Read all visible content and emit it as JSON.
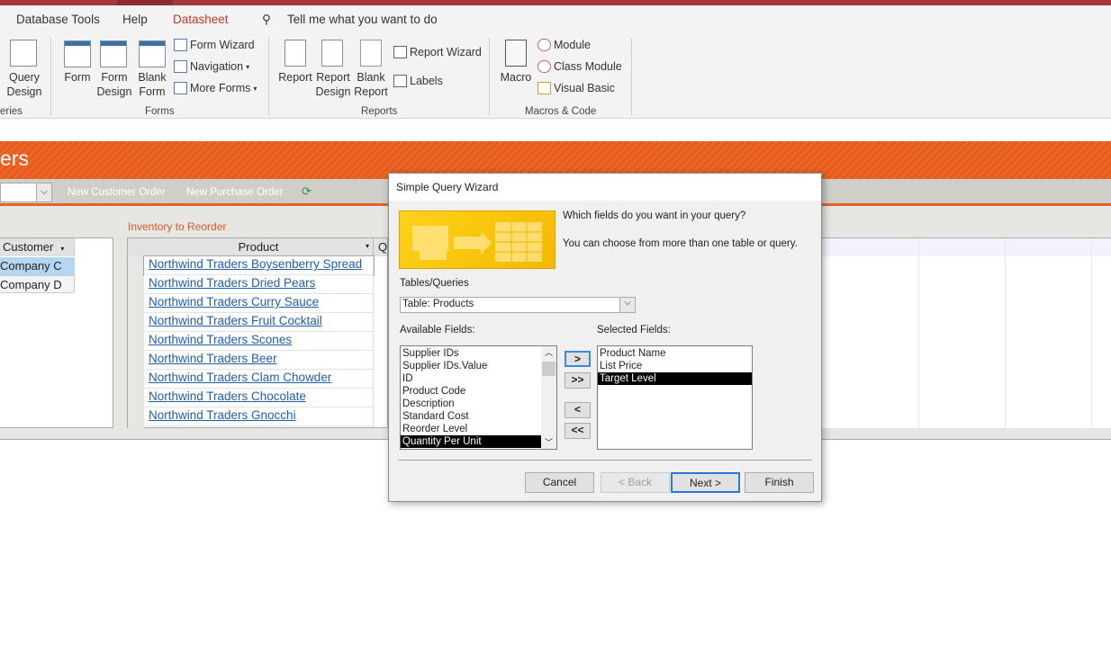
{
  "menu": {
    "items": [
      "Database Tools",
      "Help",
      "Datasheet"
    ],
    "tell_me": "Tell me what you want to do",
    "active_color": "#c0392b"
  },
  "ribbon": {
    "queries": {
      "query_design": [
        "Query",
        "Design"
      ],
      "group": "eries"
    },
    "forms": {
      "form": "Form",
      "form_design": [
        "Form",
        "Design"
      ],
      "blank_form": [
        "Blank",
        "Form"
      ],
      "form_wizard": "Form Wizard",
      "navigation": "Navigation",
      "more_forms": "More Forms",
      "group": "Forms"
    },
    "reports": {
      "report": "Report",
      "report_design": [
        "Report",
        "Design"
      ],
      "blank_report": [
        "Blank",
        "Report"
      ],
      "report_wizard": "Report Wizard",
      "labels": "Labels",
      "group": "Reports"
    },
    "macros": {
      "macro": "Macro",
      "module": "Module",
      "class_module": "Class Module",
      "visual_basic": "Visual Basic",
      "group": "Macros & Code"
    }
  },
  "form": {
    "title": "ers",
    "new_customer_order": "New Customer Order",
    "new_purchase_order": "New Purchase Order",
    "inventory_label": "Inventory to Reorder",
    "customer_header": "Customer",
    "customers": [
      "Company C",
      "Company D"
    ],
    "product_header": "Product",
    "q_header": "Q",
    "products": [
      "Northwind Traders Boysenberry Spread",
      "Northwind Traders Dried Pears",
      "Northwind Traders Curry Sauce",
      "Northwind Traders Fruit Cocktail",
      "Northwind Traders Scones",
      "Northwind Traders Beer",
      "Northwind Traders Clam Chowder",
      "Northwind Traders Chocolate",
      "Northwind Traders Gnocchi"
    ]
  },
  "wizard": {
    "title": "Simple Query Wizard",
    "question": "Which fields do you want in your query?",
    "hint": "You can choose from more than one table or query.",
    "tables_label": "Tables/Queries",
    "table_value": "Table: Products",
    "available_label": "Available Fields:",
    "available": [
      "Supplier IDs",
      "Supplier IDs.Value",
      "ID",
      "Product Code",
      "Description",
      "Standard Cost",
      "Reorder Level",
      "Quantity Per Unit"
    ],
    "available_selected": "Quantity Per Unit",
    "selected_label": "Selected Fields:",
    "selected": [
      "Product Name",
      "List Price",
      "Target Level"
    ],
    "selected_selected": "Target Level",
    "add": ">",
    "add_all": ">>",
    "remove": "<",
    "remove_all": "<<",
    "cancel": "Cancel",
    "back": "< Back",
    "next": "Next >",
    "finish": "Finish"
  }
}
